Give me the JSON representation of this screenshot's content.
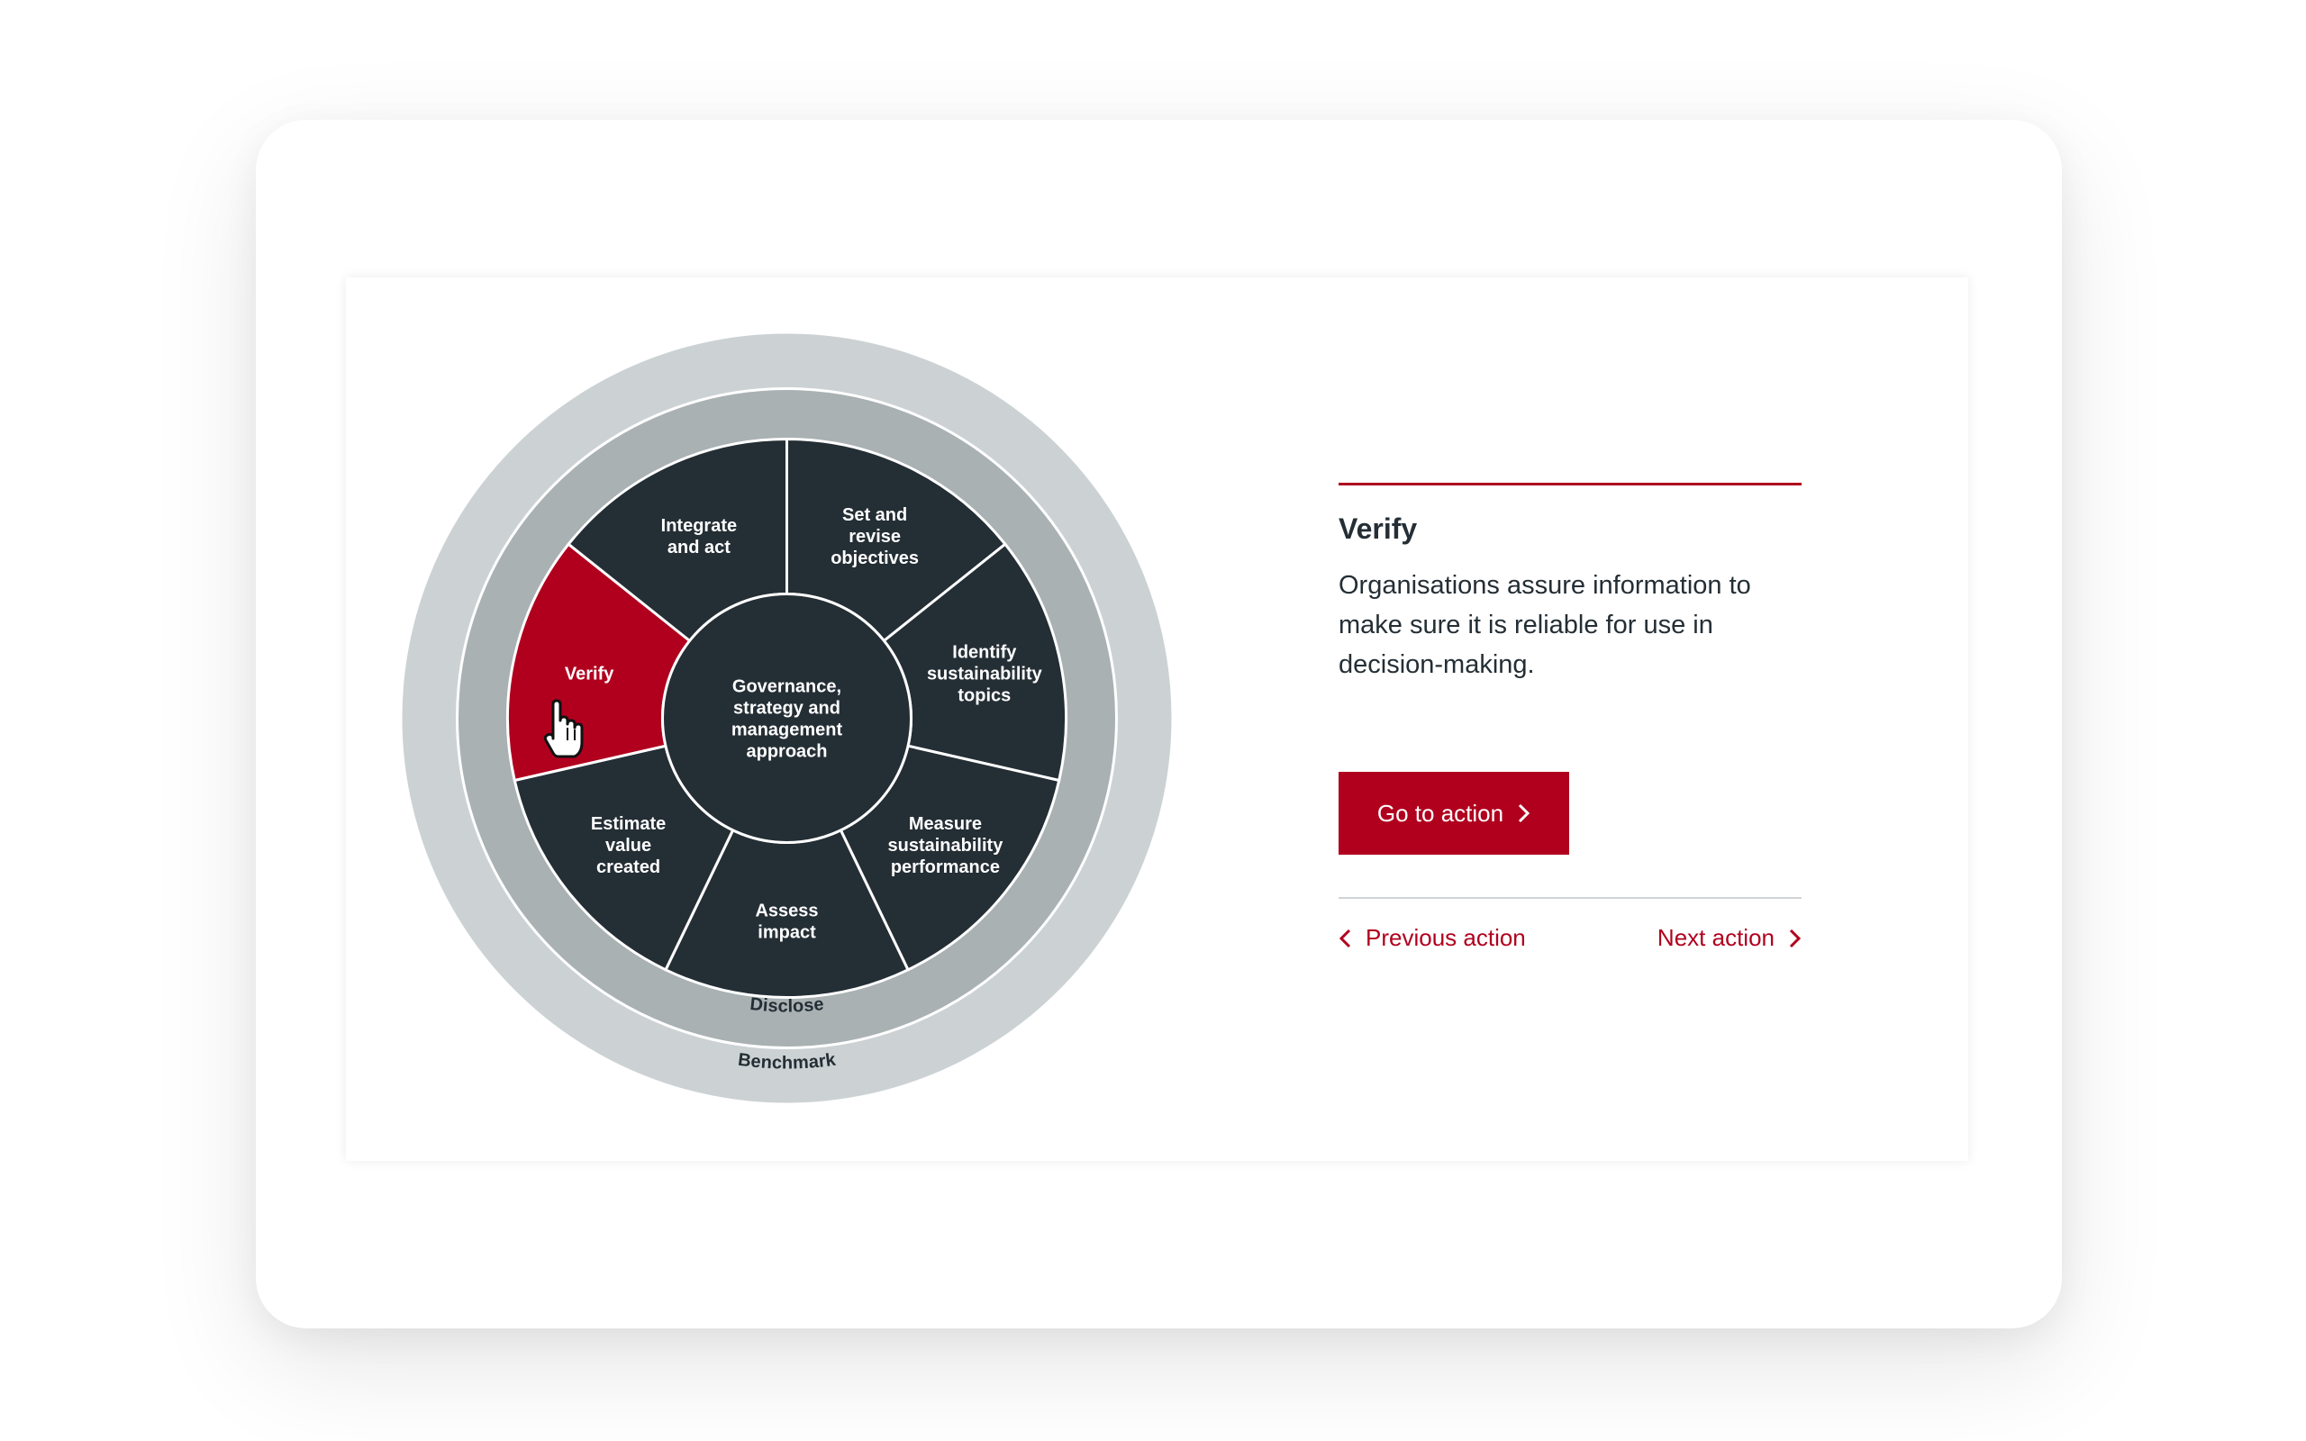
{
  "wheel": {
    "center_lines": [
      "Governance,",
      "strategy and",
      "management",
      "approach"
    ],
    "segments": [
      {
        "id": "set-and-revise-objectives",
        "lines": [
          "Set and",
          "revise",
          "objectives"
        ],
        "active": false
      },
      {
        "id": "identify-sustainability-topics",
        "lines": [
          "Identify",
          "sustainability",
          "topics"
        ],
        "active": false
      },
      {
        "id": "measure-sustainability-performance",
        "lines": [
          "Measure",
          "sustainability",
          "performance"
        ],
        "active": false
      },
      {
        "id": "assess-impact",
        "lines": [
          "Assess",
          "impact"
        ],
        "active": false
      },
      {
        "id": "estimate-value-created",
        "lines": [
          "Estimate",
          "value",
          "created"
        ],
        "active": false
      },
      {
        "id": "verify",
        "lines": [
          "Verify"
        ],
        "active": true
      },
      {
        "id": "integrate-and-act",
        "lines": [
          "Integrate",
          "and act"
        ],
        "active": false
      }
    ],
    "middle_ring_label": "Disclose",
    "outer_ring_label": "Benchmark"
  },
  "info": {
    "title": "Verify",
    "description": "Organisations assure information to make sure it is reliable for use in decision-making.",
    "go_button_label": "Go to action",
    "previous_label": "Previous action",
    "next_label": "Next action"
  },
  "colors": {
    "accent": "#b0001e",
    "segment": "#242e35",
    "ring_middle": "#a9b1b3",
    "ring_outer": "#ccd2d4",
    "text_dark": "#242e35"
  },
  "icons": {
    "cursor": "pointer-hand-icon",
    "chevron_right": "chevron-right-icon",
    "chevron_left": "chevron-left-icon"
  }
}
